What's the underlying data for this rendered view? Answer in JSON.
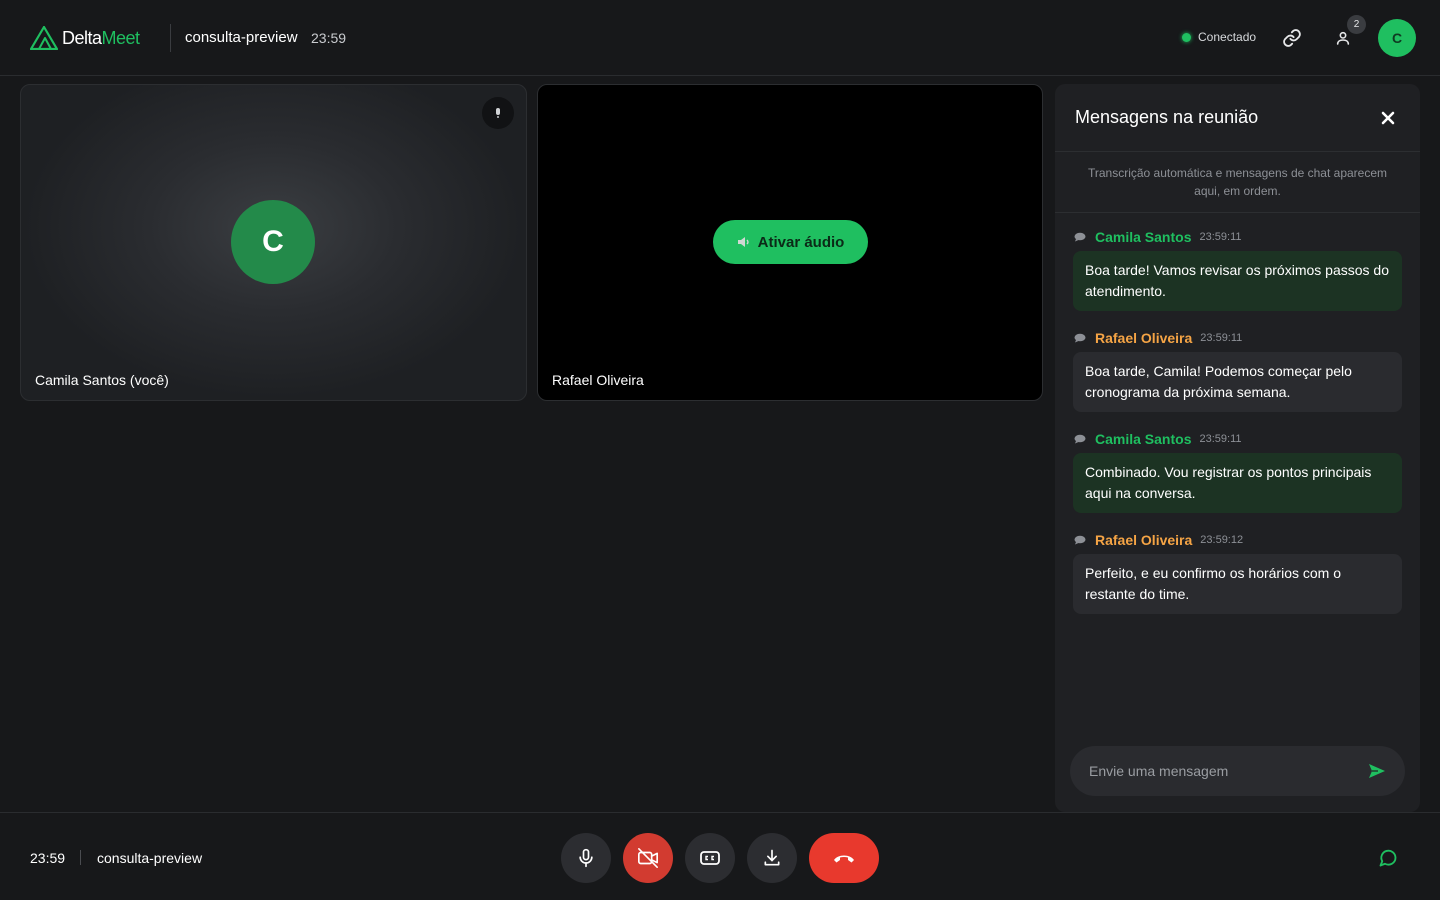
{
  "header": {
    "brand_part1": "Delta",
    "brand_part2": "Meet",
    "room_name": "consulta-preview",
    "time": "23:59",
    "status": "Conectado",
    "participants_count": "2",
    "user_initial": "C"
  },
  "tiles": {
    "self": {
      "name": "Camila Santos (você)",
      "initial": "C"
    },
    "remote": {
      "name": "Rafael Oliveira",
      "enable_audio_label": "Ativar áudio"
    }
  },
  "chat": {
    "title": "Mensagens na reunião",
    "note": "Transcrição automática e mensagens de chat aparecem aqui, em ordem.",
    "messages": [
      {
        "author": "Camila Santos",
        "time": "23:59:11",
        "text": "Boa tarde! Vamos revisar os próximos passos do atendimento."
      },
      {
        "author": "Rafael Oliveira",
        "time": "23:59:11",
        "text": "Boa tarde, Camila! Podemos começar pelo cronograma da próxima semana."
      },
      {
        "author": "Camila Santos",
        "time": "23:59:11",
        "text": "Combinado. Vou registrar os pontos principais aqui na conversa."
      },
      {
        "author": "Rafael Oliveira",
        "time": "23:59:12",
        "text": "Perfeito, e eu confirmo os horários com o restante do time."
      }
    ],
    "input_placeholder": "Envie uma mensagem"
  },
  "footer": {
    "time": "23:59",
    "room_name": "consulta-preview"
  },
  "colors": {
    "accent": "#1fbf60",
    "danger": "#e8392d",
    "other_author": "#f5a445",
    "background": "#17181a"
  },
  "icons": [
    "logo-icon",
    "link-icon",
    "people-icon",
    "mic-icon",
    "speaker-icon",
    "close-icon",
    "chat-bubble-icon",
    "send-icon",
    "camera-off-icon",
    "captions-icon",
    "download-icon",
    "hang-up-icon",
    "chat-icon"
  ]
}
